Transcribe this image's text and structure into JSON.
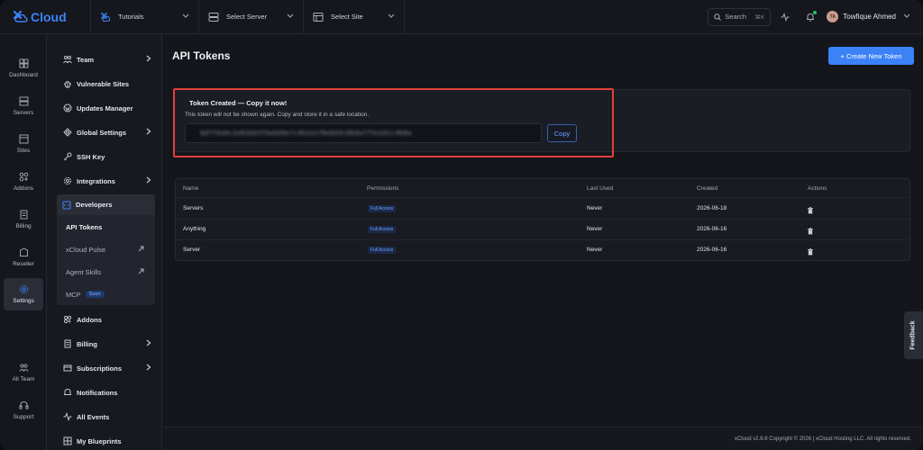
{
  "brand": {
    "name": "Cloud",
    "accent": "#3b82f6"
  },
  "topbar": {
    "crumbs": [
      {
        "label": "Tutorials",
        "icon": "xcloud-logo-icon"
      },
      {
        "label": "Select Server",
        "icon": "server-icon"
      },
      {
        "label": "Select Site",
        "icon": "site-icon"
      }
    ],
    "search_label": "Search",
    "search_shortcut": "⌘K",
    "avatar_initials": "TA",
    "user_name": "Towfique Ahmed"
  },
  "rail": [
    {
      "label": "Dashboard",
      "icon": "dashboard-icon"
    },
    {
      "label": "Servers",
      "icon": "server-icon"
    },
    {
      "label": "Sites",
      "icon": "site-icon"
    },
    {
      "label": "Addons",
      "icon": "addons-icon"
    },
    {
      "label": "Billing",
      "icon": "billing-icon"
    },
    {
      "label": "Reseller",
      "icon": "reseller-icon"
    },
    {
      "label": "Settings",
      "icon": "gear-icon"
    },
    {
      "label": "All Team",
      "icon": "team-icon"
    },
    {
      "label": "Support",
      "icon": "support-icon"
    }
  ],
  "settings_nav": {
    "items": [
      {
        "label": "Team"
      },
      {
        "label": "Vulnerable Sites"
      },
      {
        "label": "Updates Manager"
      },
      {
        "label": "Global Settings"
      },
      {
        "label": "SSH Key"
      },
      {
        "label": "Integrations"
      },
      {
        "label": "Addons"
      },
      {
        "label": "Billing"
      },
      {
        "label": "Subscriptions"
      },
      {
        "label": "Notifications"
      },
      {
        "label": "All Events"
      },
      {
        "label": "My Blueprints"
      }
    ],
    "developers": {
      "label": "Developers",
      "sub": [
        {
          "label": "API Tokens"
        },
        {
          "label": "xCloud Pulse"
        },
        {
          "label": "Agent Skills"
        },
        {
          "label": "MCP",
          "badge": "Soon"
        }
      ]
    }
  },
  "main": {
    "title": "API Tokens",
    "create_button": "+ Create New Token",
    "token_created": {
      "title": "Token Created — Copy it now!",
      "description": "This token will not be shown again. Copy and store it in a safe location.",
      "copy_label": "Copy"
    },
    "table": {
      "columns": [
        "Name",
        "Permissions",
        "Last Used",
        "Created",
        "Actions"
      ],
      "rows": [
        {
          "name": "Servers",
          "permissions": "Full Access",
          "last_used": "Never",
          "created": "2026-06-18"
        },
        {
          "name": "Anything",
          "permissions": "Full Access",
          "last_used": "Never",
          "created": "2026-06-16"
        },
        {
          "name": "Server",
          "permissions": "Full Access",
          "last_used": "Never",
          "created": "2026-06-16"
        }
      ]
    }
  },
  "footer": {
    "text": "xCloud v2.6.6 Copyright © 2026 | xCloud Hosting LLC. All rights reserved."
  },
  "feedback_label": "Feedback",
  "colors": {
    "highlight_border": "#e2403a",
    "badge_text": "#6ea0ff",
    "background": "#14161c"
  }
}
